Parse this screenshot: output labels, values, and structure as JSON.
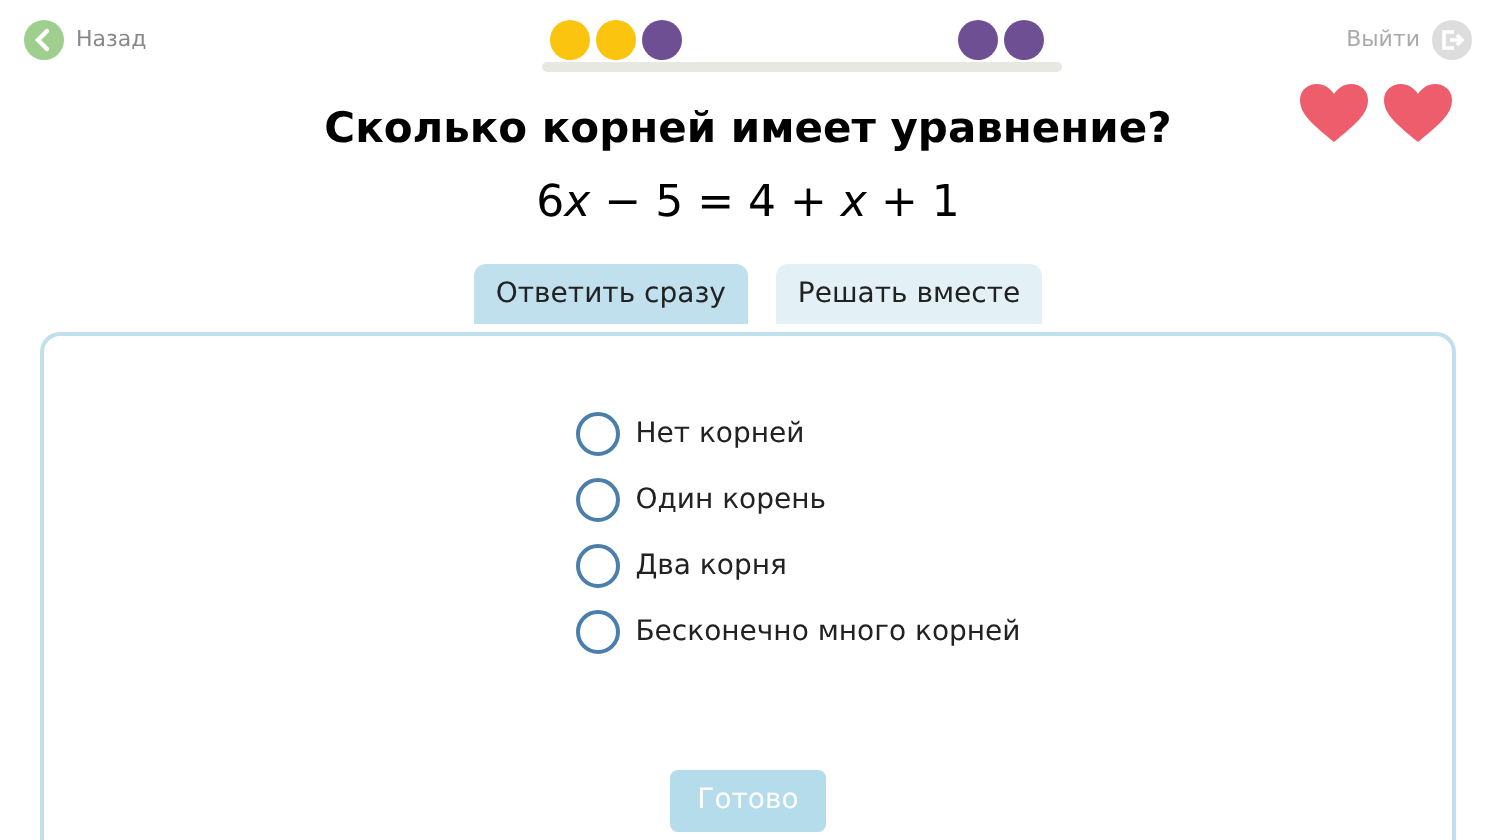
{
  "header": {
    "back": "Назад",
    "exit": "Выйти"
  },
  "progress": {
    "left": [
      {
        "color": "#fbc40f"
      },
      {
        "color": "#fbc40f"
      },
      {
        "color": "#6e4f93"
      }
    ],
    "right": [
      {
        "color": "#6e4f93"
      },
      {
        "color": "#6e4f93"
      }
    ]
  },
  "question": "Сколько корней имеет уравнение?",
  "equation": [
    {
      "text": "6",
      "italic": false
    },
    {
      "text": "x",
      "italic": true
    },
    {
      "text": " − 5 = 4 + ",
      "italic": false
    },
    {
      "text": "x",
      "italic": true
    },
    {
      "text": " + 1",
      "italic": false
    }
  ],
  "tabs": [
    {
      "label": "Ответить сразу",
      "selected": true
    },
    {
      "label": "Решать вместе",
      "selected": false
    }
  ],
  "options": [
    {
      "label": "Нет корней",
      "checked": false
    },
    {
      "label": "Один корень",
      "checked": false
    },
    {
      "label": "Два корня",
      "checked": false
    },
    {
      "label": "Бесконечно много корней",
      "checked": false
    }
  ],
  "done_button": {
    "label": "Готово",
    "disabled": true
  }
}
